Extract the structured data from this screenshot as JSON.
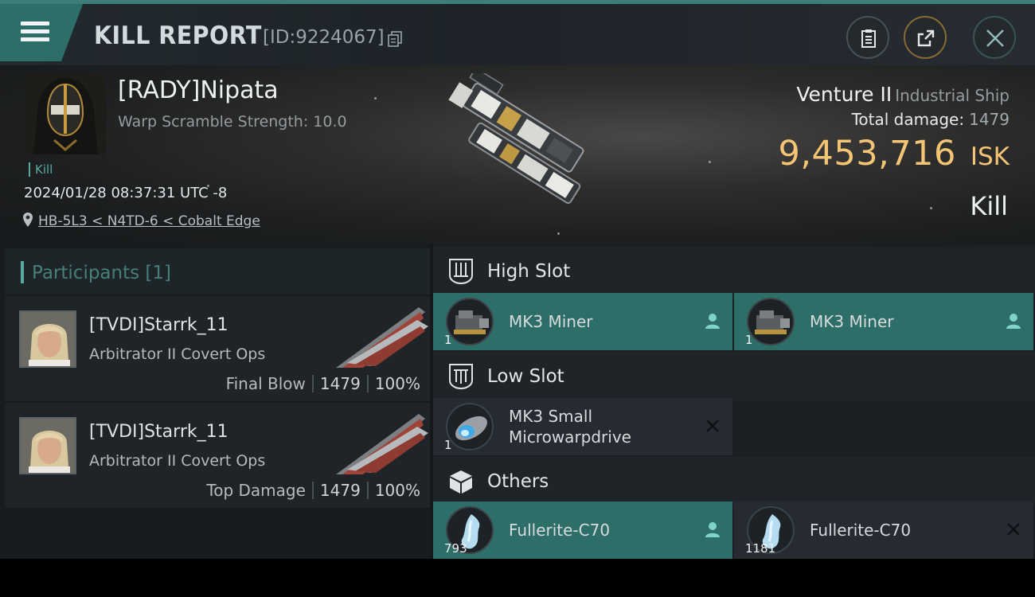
{
  "header": {
    "title": "KILL REPORT",
    "report_id": "[ID:9224067]"
  },
  "victim": {
    "name": "[RADY]Nipata",
    "warp_scramble": "Warp Scramble Strength: 10.0",
    "tag": "Kill",
    "datetime": "2024/01/28 08:37:31 UTC -8",
    "location": "HB-5L3 < N4TD-6 < Cobalt Edge",
    "ship_name": "Venture II",
    "ship_class": "Industrial Ship",
    "total_damage_label": "Total damage:",
    "total_damage": "1479",
    "isk_value": "9,453,716",
    "isk_unit": "ISK",
    "result": "Kill"
  },
  "participants": {
    "title": "Participants [1]",
    "rows": [
      {
        "name": "[TVDI]Starrk_11",
        "ship": "Arbitrator II Covert Ops",
        "role": "Final Blow",
        "damage": "1479",
        "percent": "100%"
      },
      {
        "name": "[TVDI]Starrk_11",
        "ship": "Arbitrator II Covert Ops",
        "role": "Top Damage",
        "damage": "1479",
        "percent": "100%"
      }
    ]
  },
  "fitting": {
    "high": {
      "title": "High Slot",
      "items": [
        {
          "name": "MK3 Miner",
          "qty": "1",
          "status": "dropped"
        },
        {
          "name": "MK3 Miner",
          "qty": "1",
          "status": "dropped"
        }
      ]
    },
    "low": {
      "title": "Low Slot",
      "items": [
        {
          "name_line1": "MK3 Small",
          "name_line2": "Microwarpdrive",
          "qty": "1",
          "status": "destroyed"
        }
      ]
    },
    "others": {
      "title": "Others",
      "items": [
        {
          "name": "Fullerite-C70",
          "qty": "793",
          "status": "dropped"
        },
        {
          "name": "Fullerite-C70",
          "qty": "1181",
          "status": "destroyed"
        }
      ]
    }
  },
  "colors": {
    "accent_teal": "#2e6e69",
    "isk_gold": "#f3c575",
    "background": "#15191d"
  },
  "icons": {
    "menu": "hamburger-icon",
    "copy": "copy-icon",
    "clipboard": "clipboard-icon",
    "share": "share-icon",
    "close": "close-icon",
    "location": "location-pin-icon",
    "high_slot": "high-slot-icon",
    "low_slot": "low-slot-icon",
    "others": "cargo-box-icon",
    "dropped": "person-icon",
    "destroyed": "x-icon"
  }
}
